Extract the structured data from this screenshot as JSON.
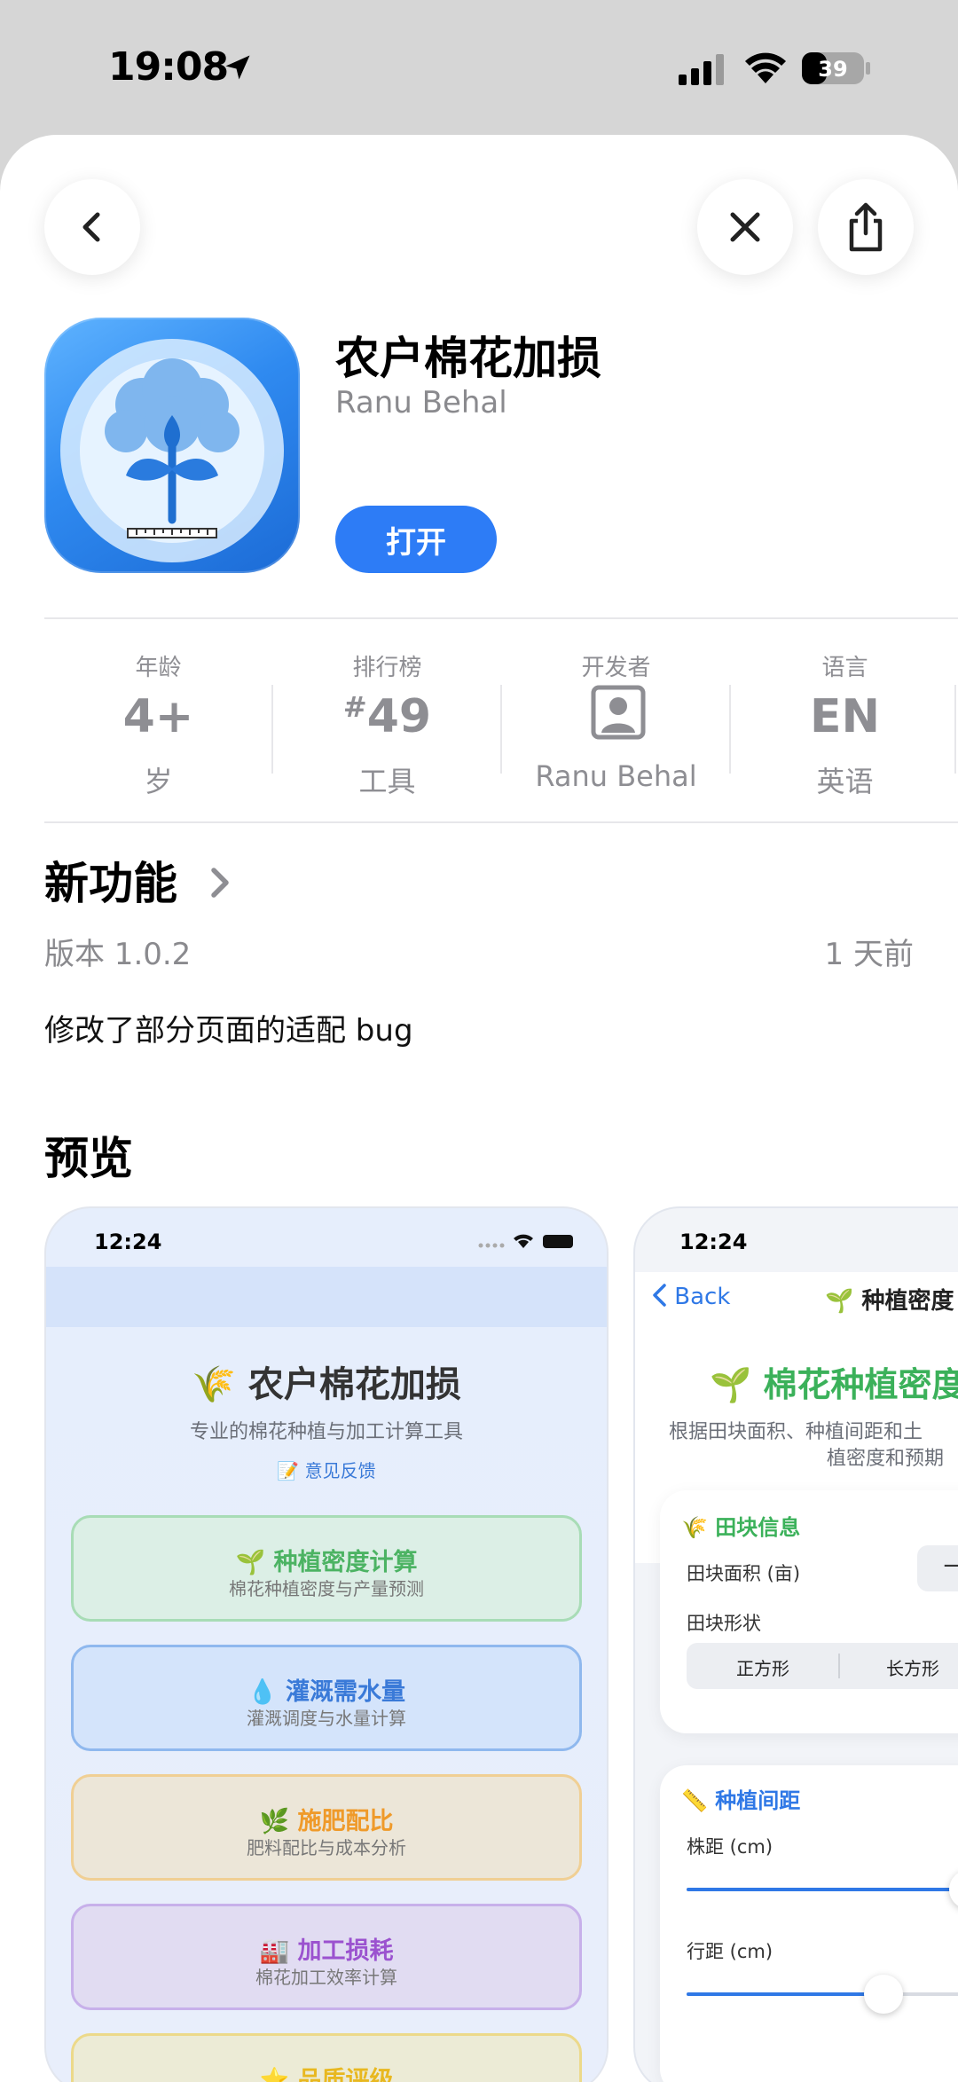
{
  "status_bar": {
    "time": "19:08",
    "battery": "39"
  },
  "header": {
    "back_icon": "chevron-left-icon",
    "close_icon": "close-icon",
    "share_icon": "share-icon"
  },
  "app": {
    "title": "农户棉花加损",
    "developer": "Ranu Behal",
    "open_label": "打开"
  },
  "info": [
    {
      "label": "年龄",
      "value": "4+",
      "sub": "岁"
    },
    {
      "label": "排行榜",
      "value_prefix": "#",
      "value": "49",
      "sub": "工具"
    },
    {
      "label": "开发者",
      "icon": "person-icon",
      "sub": "Ranu Behal"
    },
    {
      "label": "语言",
      "value": "EN",
      "sub": "英语"
    }
  ],
  "whats_new": {
    "title": "新功能",
    "version": "版本 1.0.2",
    "ago": "1 天前",
    "notes": "修改了部分页面的适配 bug"
  },
  "preview": {
    "title": "预览",
    "shot1": {
      "time": "12:24",
      "title": "农户棉花加损",
      "subtitle": "专业的棉花种植与加工计算工具",
      "feedback": "意见反馈",
      "cards": [
        {
          "title": "种植密度计算",
          "sub": "棉花种植密度与产量预测",
          "color": "#5cc06e",
          "bg": "#dcefe6"
        },
        {
          "title": "灌溉需水量",
          "sub": "灌溉调度与水量计算",
          "color": "#3a7ad8",
          "bg": "#d4e4fb"
        },
        {
          "title": "施肥配比",
          "sub": "肥料配比与成本分析",
          "color": "#f0a030",
          "bg": "#ece6d8"
        },
        {
          "title": "加工损耗",
          "sub": "棉花加工效率计算",
          "color": "#a05ad0",
          "bg": "#e1dcf2"
        },
        {
          "title": "品质评级",
          "sub": "",
          "color": "#e8c030",
          "bg": "#ecebd6"
        }
      ]
    },
    "shot2": {
      "time": "12:24",
      "back": "Back",
      "nav_title": "种植密度",
      "title": "棉花种植密度",
      "desc_line1": "根据田块面积、种植间距和土",
      "desc_line2": "植密度和预期",
      "panel1": {
        "title": "田块信息",
        "area_label": "田块面积 (亩)",
        "shape_label": "田块形状",
        "shape_options": [
          "正方形",
          "长方形"
        ]
      },
      "panel2": {
        "title": "种植间距",
        "plant_label": "株距 (cm)",
        "row_label": "行距 (cm)",
        "plant_level": 0.53,
        "row_level": 0.37
      }
    }
  }
}
